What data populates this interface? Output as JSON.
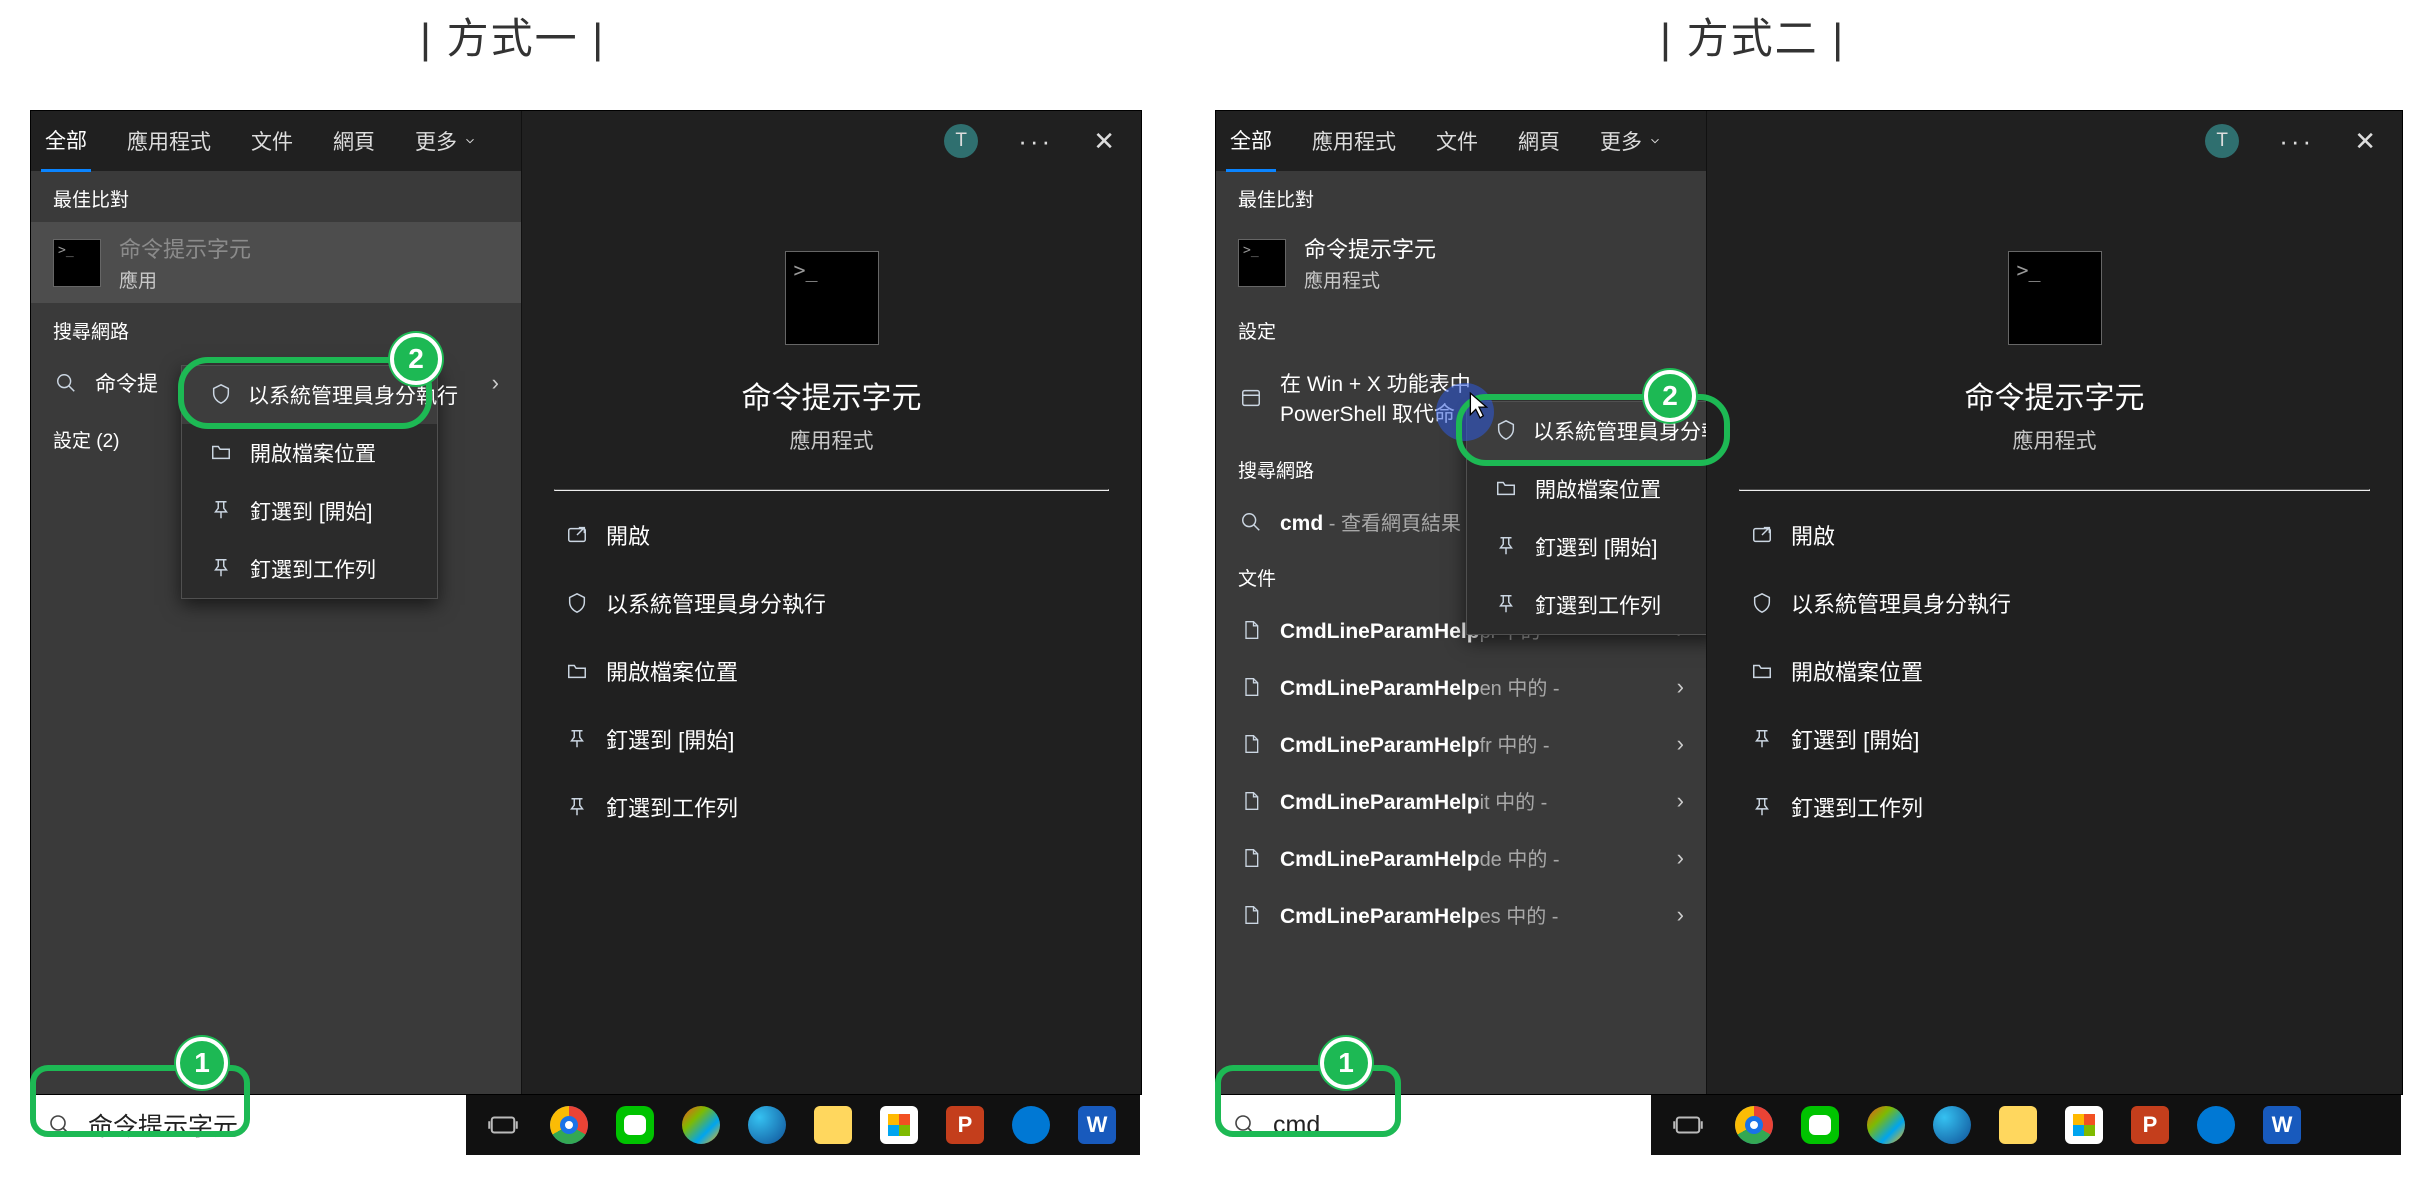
{
  "methods": {
    "m1": "| 方式一 |",
    "m2": "| 方式二 |"
  },
  "tabs": {
    "all": "全部",
    "apps": "應用程式",
    "docs": "文件",
    "web": "網頁",
    "more": "更多",
    "avatar_initial": "T",
    "dots": "···",
    "close": "✕"
  },
  "sections": {
    "best_match": "最佳比對",
    "settings": "設定",
    "search_web": "搜尋網路",
    "docs": "文件"
  },
  "app": {
    "name": "命令提示字元",
    "sub": "應用程式",
    "sub_truncated": "應用"
  },
  "ctx": {
    "run_admin": "以系統管理員身分執行",
    "open_loc": "開啟檔案位置",
    "pin_start": "釘選到 [開始]",
    "pin_taskbar": "釘選到工作列"
  },
  "right": {
    "open": "開啟",
    "run_admin": "以系統管理員身分執行",
    "open_loc": "開啟檔案位置",
    "pin_start": "釘選到 [開始]",
    "pin_taskbar": "釘選到工作列"
  },
  "p1": {
    "web_row_prefix": "命令提",
    "settings_count": "設定 (2)",
    "taskbar_search": "命令提示字元"
  },
  "p2": {
    "settings_row_l1": "在 Win + X 功能表中",
    "settings_row_l2": "PowerShell 取代命",
    "web_row_main": "cmd",
    "web_row_suffix": " - 查看網頁結果",
    "doc_rows": [
      {
        "bold": "CmdLineParamHelp",
        "tail": "pl 中的 -"
      },
      {
        "bold": "CmdLineParamHelp",
        "tail": "en 中的 -"
      },
      {
        "bold": "CmdLineParamHelp",
        "tail": "fr 中的 -"
      },
      {
        "bold": "CmdLineParamHelp",
        "tail": "it 中的 -"
      },
      {
        "bold": "CmdLineParamHelp",
        "tail": "de 中的 -"
      },
      {
        "bold": "CmdLineParamHelp",
        "tail": "es 中的 -"
      }
    ],
    "taskbar_search": "cmd"
  },
  "colors": {
    "accent": "#1db954"
  }
}
